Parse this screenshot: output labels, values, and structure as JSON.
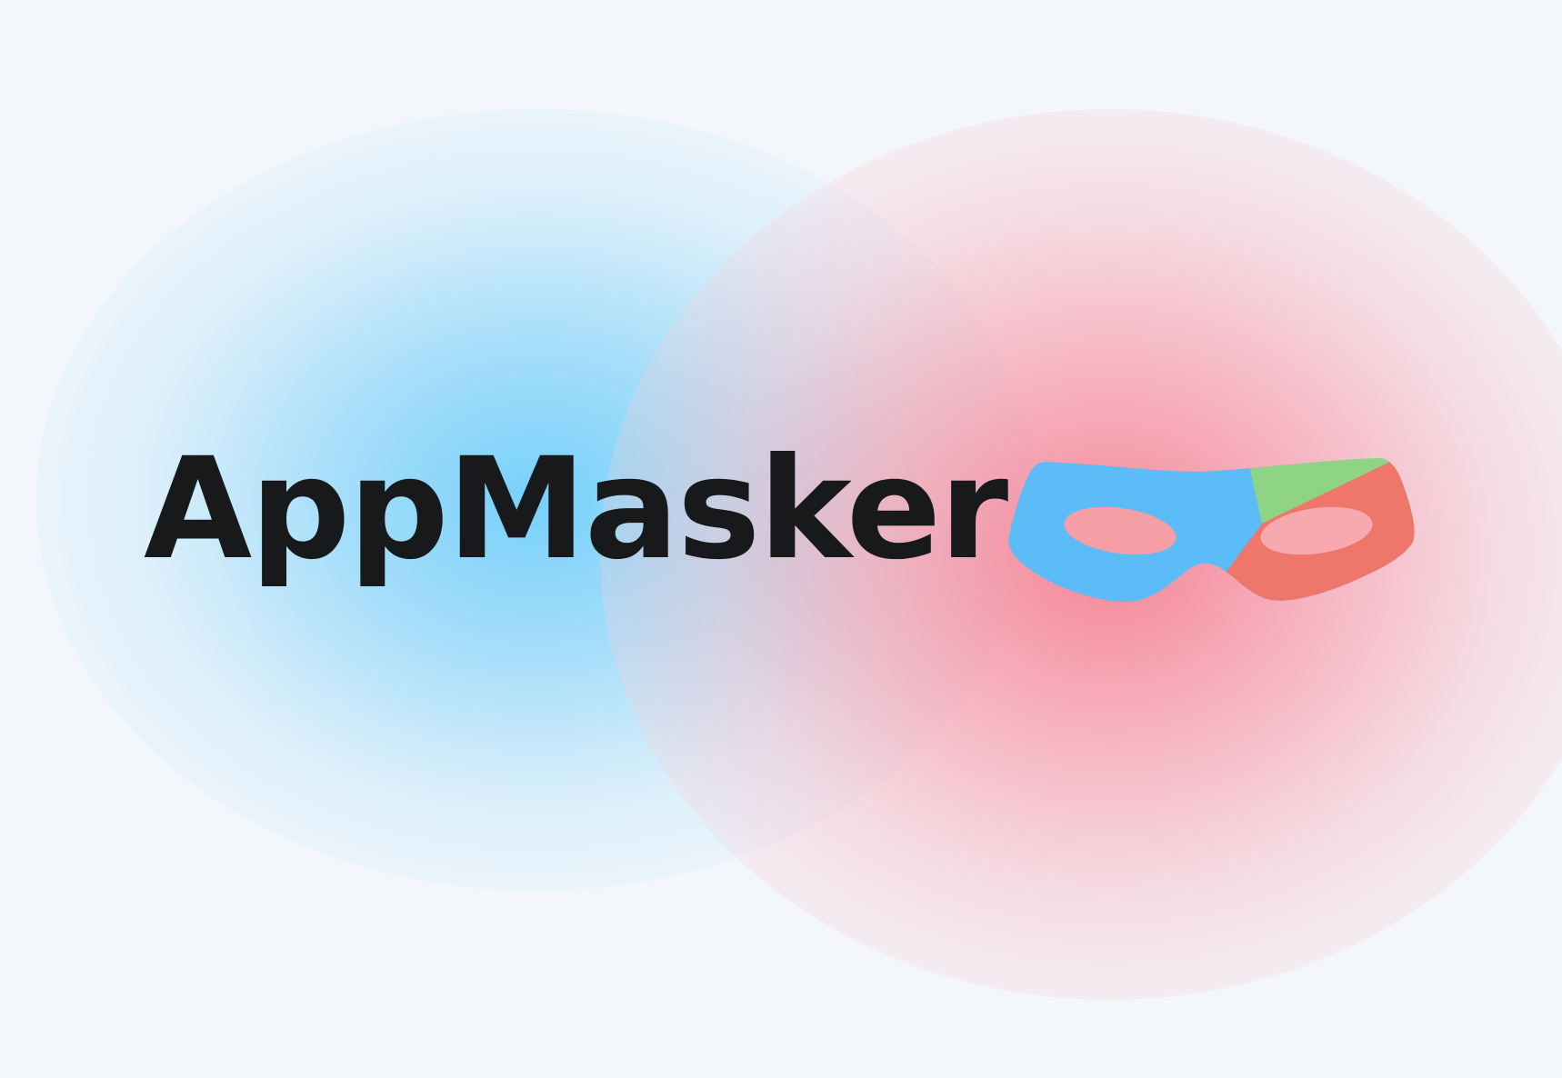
{
  "brand": {
    "name": "AppMasker",
    "logo_icon": "mask-icon"
  },
  "colors": {
    "background": "#f3f6fb",
    "glow_blue": "#70cefa",
    "glow_pink": "#f5788c",
    "text": "#17191b",
    "mask_blue": "#5bbcf8",
    "mask_green": "#8fd485",
    "mask_red": "#ee766a",
    "mask_eye": "#f59ea6"
  }
}
